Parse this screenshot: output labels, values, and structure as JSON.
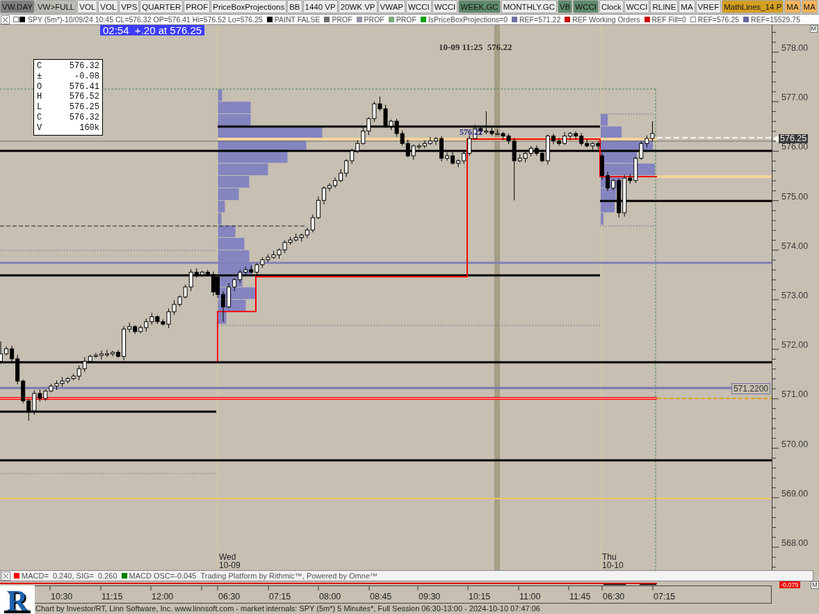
{
  "toolbar": [
    {
      "label": "VW.DAY",
      "color": "#7f7f7f"
    },
    {
      "label": "VW>FULL",
      "color": "#bcbcb4"
    },
    {
      "label": "VOL",
      "color": "#ececec"
    },
    {
      "label": "VOL",
      "color": "#ececec"
    },
    {
      "label": "VPS",
      "color": "#ececec"
    },
    {
      "label": "QUARTER",
      "color": "#ececec"
    },
    {
      "label": "PROF",
      "color": "#ececec"
    },
    {
      "label": "PriceBoxProjections",
      "color": "#ececec"
    },
    {
      "label": "BB",
      "color": "#ececec"
    },
    {
      "label": "1440 VP",
      "color": "#ececec"
    },
    {
      "label": "20WK VP",
      "color": "#ececec"
    },
    {
      "label": "VWAP",
      "color": "#ececec"
    },
    {
      "label": "WCCI",
      "color": "#ececec"
    },
    {
      "label": "WCCI",
      "color": "#ececec"
    },
    {
      "label": "WEEK.GC",
      "color": "#5f8a6c"
    },
    {
      "label": "MONTHLY.GC",
      "color": "#ececec"
    },
    {
      "label": "VB",
      "color": "#5f8a6c"
    },
    {
      "label": "WCCI",
      "color": "#5f8a6c"
    },
    {
      "label": "Clock",
      "color": "#ececec"
    },
    {
      "label": "WCCI",
      "color": "#ececec"
    },
    {
      "label": "RLINE",
      "color": "#ececec"
    },
    {
      "label": "MA",
      "color": "#ececec"
    },
    {
      "label": "VREF",
      "color": "#ececec"
    },
    {
      "label": "MathLines_14 P",
      "color": "#d4a020"
    },
    {
      "label": "MA",
      "color": "#f4b45c"
    },
    {
      "label": "MA",
      "color": "#f4b45c"
    }
  ],
  "legend": {
    "title": "SPY (5m*)-10/09/24 10:45 CL=576.32 OP=576.41 Hi=576.52 Lo=576.25",
    "items": [
      {
        "label": "PAINT FALSE",
        "color": "#000000"
      },
      {
        "label": "PROF",
        "color": "#6e6e6e"
      },
      {
        "label": "PROF",
        "color": "#9890a8"
      },
      {
        "label": "PROF",
        "color": "#7aa878"
      },
      {
        "label": "IsPriceBoxProjections=0",
        "color": "#10a010"
      },
      {
        "label": "REF=571.22",
        "color": "#7070a0"
      },
      {
        "label": "REF Working Orders",
        "color": "#cc0000"
      },
      {
        "label": "REF Fill=0",
        "color": "#cc0000"
      },
      {
        "label": "REF=576.25",
        "color": "#ffffff"
      },
      {
        "label": "REF=15529.75",
        "color": "#6868a0"
      }
    ]
  },
  "chart": {
    "countdown": "02:54  +.20 at 576.25",
    "data_window": [
      {
        "label": "C",
        "value": "576.32"
      },
      {
        "label": "±",
        "value": "-0.08"
      },
      {
        "label": "O",
        "value": "576.41"
      },
      {
        "label": "H",
        "value": "576.52"
      },
      {
        "label": "L",
        "value": "576.25"
      },
      {
        "label": "C",
        "value": "576.32"
      },
      {
        "label": "V",
        "value": "160k"
      }
    ],
    "cursor_label": "10-09 11:25  576.22",
    "level_label": "576.22",
    "day_labels": [
      {
        "day": "Wed",
        "date": "10-09"
      },
      {
        "day": "Thu",
        "date": "10-10"
      }
    ],
    "price_tags": [
      {
        "kind": "reference",
        "text": "571.2200"
      }
    ]
  },
  "price_axis": {
    "mode_button": "M",
    "last_price": "576.25",
    "labels": [
      "578.00",
      "577.00",
      "576.00",
      "575.00",
      "574.00",
      "573.00",
      "572.00",
      "571.00",
      "570.00",
      "569.00",
      "568.00"
    ]
  },
  "indicator_legend": {
    "items": [
      {
        "label": "MACD=  0.240, SIG=  0.260",
        "color": "#ff0000"
      },
      {
        "label": "MACD OSC=-0.045",
        "color": "#008000"
      }
    ],
    "credit": "Trading Platform by Rithmic™, Powered by Omne™"
  },
  "macd_axis": {
    "tag": "-0.079",
    "mode_button": "M"
  },
  "time_axis": {
    "labels": [
      "10:30",
      "11:15",
      "12:00",
      "06:30",
      "07:15",
      "08:00",
      "08:45",
      "09:30",
      "10:15",
      "11:00",
      "11:45",
      "06:30",
      "07:15"
    ]
  },
  "logo": {
    "mark": "R"
  },
  "footer": "Chart by Investor/RT, Linn Software, Inc. www.linnsoft.com - market internals: SPY (5m*) 5 Minutes*, Full Session 06:30-13:00 - 2024-10-10 07:47:06"
}
